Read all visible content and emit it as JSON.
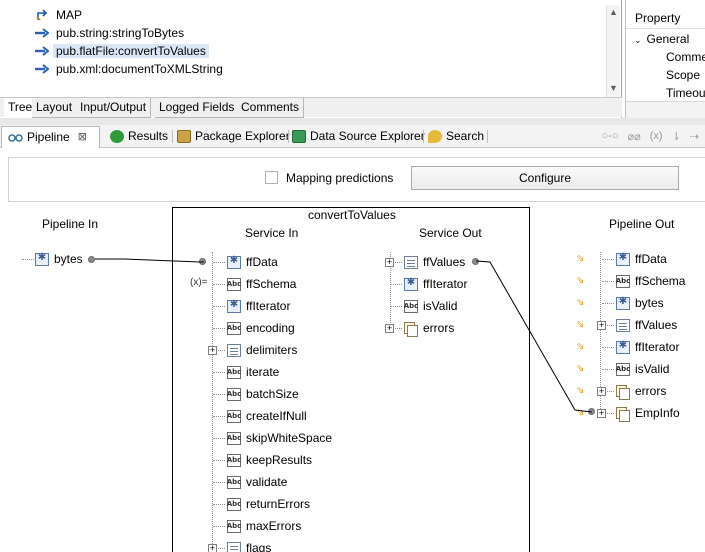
{
  "steps": [
    {
      "label": "MAP",
      "icon": "map-icon"
    },
    {
      "label": "pub.string:stringToBytes",
      "icon": "invoke-arrow-icon"
    },
    {
      "label": "pub.flatFile:convertToValues",
      "icon": "invoke-arrow-icon",
      "selected": true
    },
    {
      "label": "pub.xml:documentToXMLString",
      "icon": "invoke-arrow-icon"
    }
  ],
  "bottom_tabs": [
    "Tree",
    "Layout",
    "Input/Output",
    "Logged Fields",
    "Comments"
  ],
  "properties": {
    "header": "Property",
    "group": "General",
    "rows": [
      "Comme",
      "Scope",
      "Timeou"
    ]
  },
  "view_tabs": [
    {
      "label": "Pipeline",
      "close": "⊠"
    },
    {
      "label": "Results"
    },
    {
      "label": "Package Explorer"
    },
    {
      "label": "Data Source Explorer"
    },
    {
      "label": "Search"
    }
  ],
  "config": {
    "mapping_predictions": "Mapping predictions",
    "configure": "Configure"
  },
  "pipeline_in": {
    "title": "Pipeline In",
    "items": [
      {
        "name": "bytes",
        "icon": "object"
      }
    ]
  },
  "service": {
    "title": "convertToValues",
    "in_title": "Service In",
    "out_title": "Service Out",
    "inputs": [
      {
        "name": "ffData",
        "icon": "object"
      },
      {
        "name": "ffSchema",
        "icon": "string"
      },
      {
        "name": "ffIterator",
        "icon": "object"
      },
      {
        "name": "encoding",
        "icon": "string"
      },
      {
        "name": "delimiters",
        "icon": "doc",
        "expand": true
      },
      {
        "name": "iterate",
        "icon": "string"
      },
      {
        "name": "batchSize",
        "icon": "string"
      },
      {
        "name": "createIfNull",
        "icon": "string"
      },
      {
        "name": "skipWhiteSpace",
        "icon": "string"
      },
      {
        "name": "keepResults",
        "icon": "string"
      },
      {
        "name": "validate",
        "icon": "string"
      },
      {
        "name": "returnErrors",
        "icon": "string"
      },
      {
        "name": "maxErrors",
        "icon": "string"
      },
      {
        "name": "flags",
        "icon": "doc",
        "expand": true
      }
    ],
    "outputs": [
      {
        "name": "ffValues",
        "icon": "doc",
        "expand": true
      },
      {
        "name": "ffIterator",
        "icon": "object"
      },
      {
        "name": "isValid",
        "icon": "string"
      },
      {
        "name": "errors",
        "icon": "doclist",
        "expand": true
      }
    ],
    "set_value_marker": "(x)="
  },
  "pipeline_out": {
    "title": "Pipeline Out",
    "items": [
      {
        "name": "ffData",
        "icon": "object"
      },
      {
        "name": "ffSchema",
        "icon": "string"
      },
      {
        "name": "bytes",
        "icon": "object"
      },
      {
        "name": "ffValues",
        "icon": "doc",
        "expand": true
      },
      {
        "name": "ffIterator",
        "icon": "object"
      },
      {
        "name": "isValid",
        "icon": "string"
      },
      {
        "name": "errors",
        "icon": "doclist",
        "expand": true
      },
      {
        "name": "EmpInfo",
        "icon": "doclist",
        "expand": true
      }
    ]
  }
}
